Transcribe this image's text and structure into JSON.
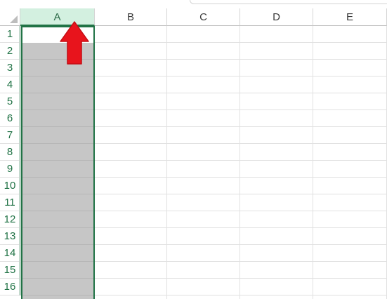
{
  "spreadsheet": {
    "columns": [
      "A",
      "B",
      "C",
      "D",
      "E"
    ],
    "selected_column": "A",
    "rows": [
      "1",
      "2",
      "3",
      "4",
      "5",
      "6",
      "7",
      "8",
      "9",
      "10",
      "11",
      "12",
      "13",
      "14",
      "15",
      "16"
    ],
    "selected_cells": "A1:A16"
  },
  "annotation": {
    "arrow_direction": "up",
    "arrow_color": "#e8141c",
    "points_to": "column A header"
  },
  "colors": {
    "selection_green": "#217346",
    "header_selected_bg": "#d3f0e0",
    "selected_range_fill": "#c6c6c6",
    "gridline": "#e1e1e1"
  }
}
